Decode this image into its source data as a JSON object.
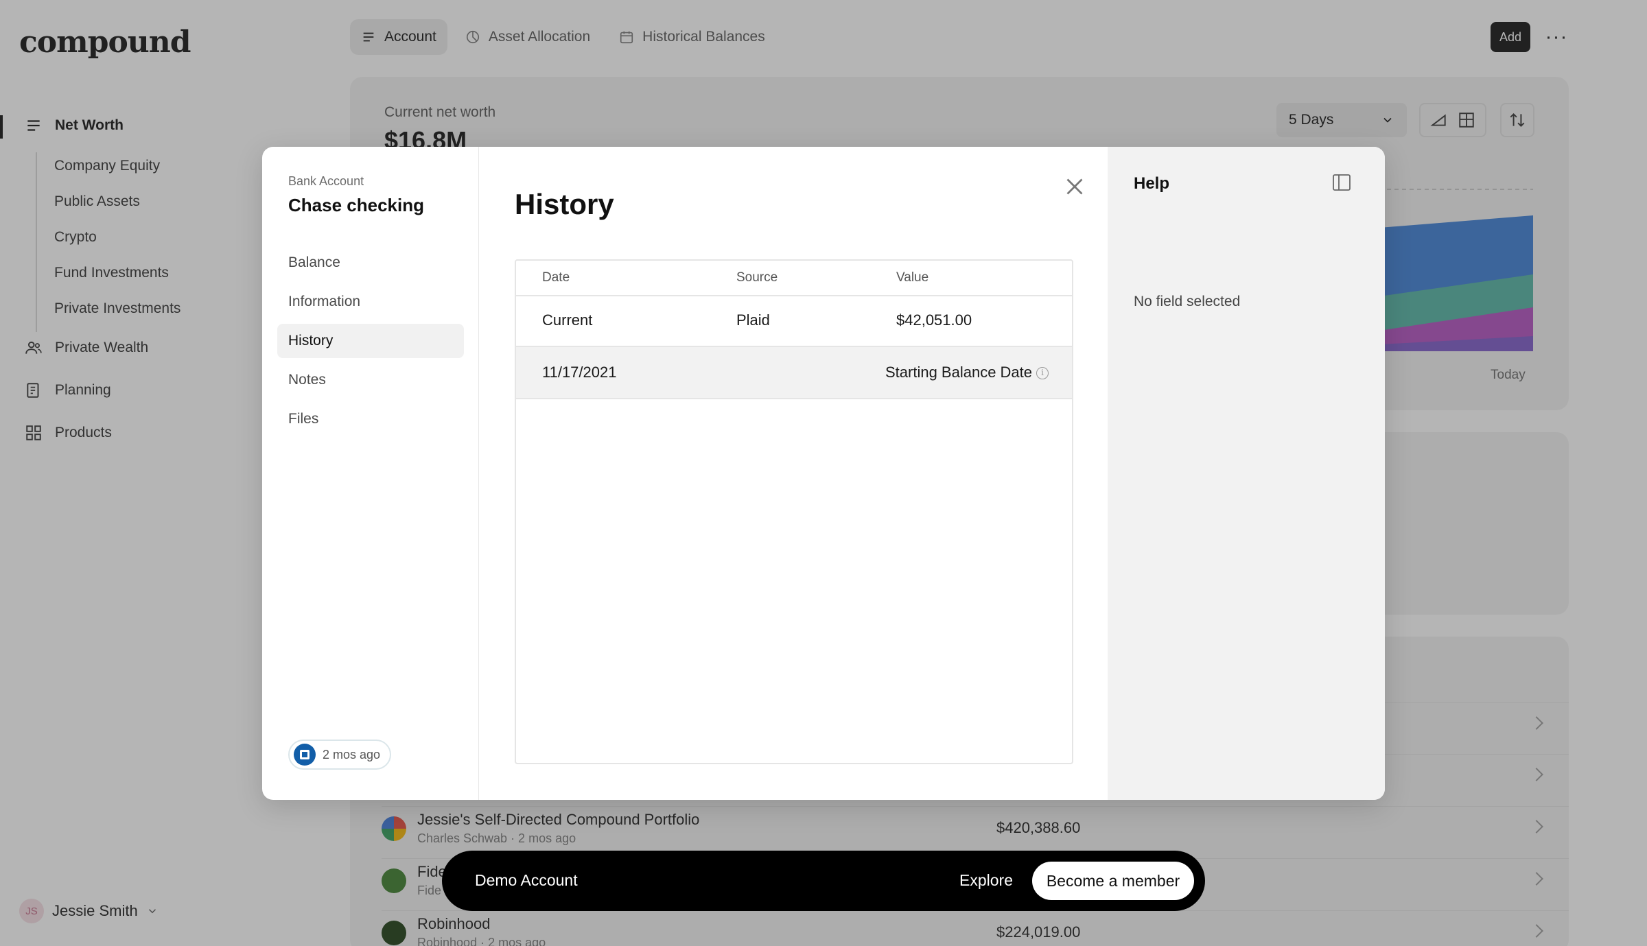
{
  "app": {
    "logo": "compound",
    "nav": {
      "net_worth": "Net Worth",
      "sub_items": [
        "Company Equity",
        "Public Assets",
        "Crypto",
        "Fund Investments",
        "Private Investments"
      ],
      "private_wealth": "Private Wealth",
      "planning": "Planning",
      "products": "Products"
    },
    "user": {
      "initials": "JS",
      "name": "Jessie Smith"
    },
    "tabs": {
      "account": "Account",
      "asset_allocation": "Asset Allocation",
      "historical_balances": "Historical Balances"
    },
    "add_button": "Add",
    "overview": {
      "net_worth_label": "Current net worth",
      "net_worth_value": "$16.8M",
      "period": "5 Days",
      "today_label": "Today"
    },
    "accounts": [
      {
        "name": "Jessie's Self-Directed Compound Portfolio",
        "sub": "Charles Schwab · 2 mos ago",
        "value": "$420,388.60"
      },
      {
        "name": "Fide",
        "sub": "Fide",
        "value": ""
      },
      {
        "name": "Robinhood",
        "sub": "Robinhood · 2 mos ago",
        "value": "$224,019.00"
      }
    ]
  },
  "modal": {
    "account_type": "Bank Account",
    "account_name": "Chase checking",
    "nav": [
      "Balance",
      "Information",
      "History",
      "Notes",
      "Files"
    ],
    "sync_status": "2 mos ago",
    "title": "History",
    "table": {
      "headers": {
        "date": "Date",
        "source": "Source",
        "value": "Value"
      },
      "current_row": {
        "date": "Current",
        "source": "Plaid",
        "value": "$42,051.00"
      },
      "start_row": {
        "date": "11/17/2021",
        "label": "Starting Balance Date"
      }
    },
    "help": {
      "title": "Help",
      "empty": "No field selected"
    }
  },
  "demo_bar": {
    "label": "Demo Account",
    "explore": "Explore",
    "member": "Become a member"
  }
}
